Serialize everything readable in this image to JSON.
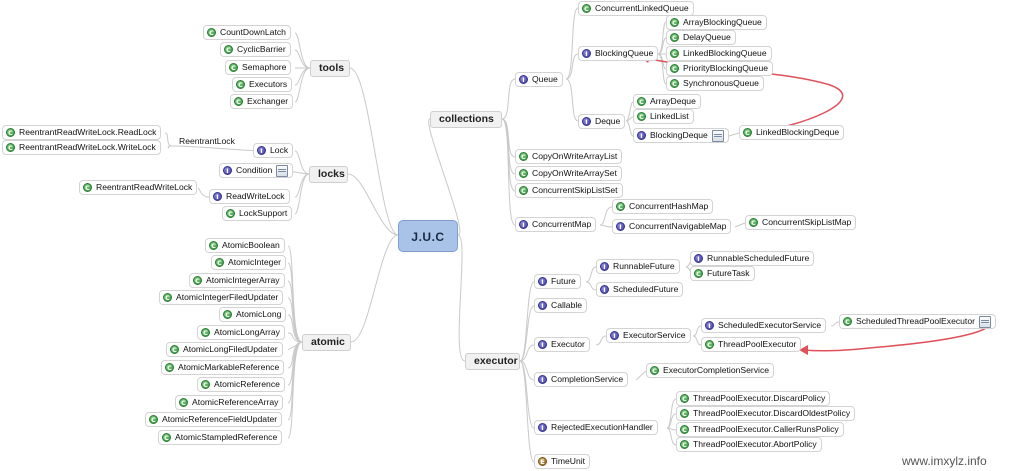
{
  "root": "J.U.C",
  "branches": {
    "tools": "tools",
    "locks": "locks",
    "atomic": "atomic",
    "collections": "collections",
    "executor": "executor"
  },
  "tools": [
    "CountDownLatch",
    "CyclicBarrier",
    "Semaphore",
    "Executors",
    "Exchanger"
  ],
  "locks": {
    "lock": "Lock",
    "reentrant_lock_label": "ReentrantLock",
    "rrwl_readlock": "ReentrantReadWriteLock.ReadLock",
    "rrwl_writelock": "ReentrantReadWriteLock.WriteLock",
    "condition": "Condition",
    "read_write_lock": "ReadWriteLock",
    "rrwl": "ReentrantReadWriteLock",
    "lock_support": "LockSupport"
  },
  "atomic": [
    "AtomicBoolean",
    "AtomicInteger",
    "AtomicIntegerArray",
    "AtomicIntegerFiledUpdater",
    "AtomicLong",
    "AtomicLongArray",
    "AtomicLongFiledUpdater",
    "AtomicMarkableReference",
    "AtomicReference",
    "AtomicReferenceArray",
    "AtomicReferenceFieldUpdater",
    "AtomicStampledReference"
  ],
  "collections": {
    "concurrent_linked_queue": "ConcurrentLinkedQueue",
    "queue": "Queue",
    "blocking_queue": "BlockingQueue",
    "blocking_queue_impls": [
      "ArrayBlockingQueue",
      "DelayQueue",
      "LinkedBlockingQueue",
      "PriorityBlockingQueue",
      "SynchronousQueue"
    ],
    "deque": "Deque",
    "deque_impls": [
      "ArrayDeque",
      "LinkedList"
    ],
    "blocking_deque": "BlockingDeque",
    "linked_blocking_deque": "LinkedBlockingDeque",
    "copy_on_write_array_list": "CopyOnWriteArrayList",
    "copy_on_write_array_set": "CopyOnWriteArraySet",
    "concurrent_skip_list_set": "ConcurrentSkipListSet",
    "concurrent_map": "ConcurrentMap",
    "concurrent_hash_map": "ConcurrentHashMap",
    "concurrent_navigable_map": "ConcurrentNavigableMap",
    "concurrent_skip_list_map": "ConcurrentSkipListMap"
  },
  "executor": {
    "future": "Future",
    "runnable_future": "RunnableFuture",
    "runnable_scheduled_future": "RunnableScheduledFuture",
    "future_task": "FutureTask",
    "scheduled_future": "ScheduledFuture",
    "callable": "Callable",
    "executor": "Executor",
    "executor_service": "ExecutorService",
    "scheduled_executor_service": "ScheduledExecutorService",
    "scheduled_thread_pool_executor": "ScheduledThreadPoolExecutor",
    "thread_pool_executor": "ThreadPoolExecutor",
    "completion_service": "CompletionService",
    "executor_completion_service": "ExecutorCompletionService",
    "rejected_execution_handler": "RejectedExecutionHandler",
    "policies": [
      "ThreadPoolExecutor.DiscardPolicy",
      "ThreadPoolExecutor.DiscardOldestPolicy",
      "ThreadPoolExecutor.CallerRunsPolicy",
      "ThreadPoolExecutor.AbortPolicy"
    ],
    "time_unit": "TimeUnit"
  },
  "watermark": "www.imxylz.info",
  "colors": {
    "class_icon": "#2f8f3a",
    "interface_icon": "#3b3aa0",
    "enum_icon": "#8a5d20",
    "root_fill": "#a9c2e8",
    "relation_arrow": "#e0505a"
  }
}
